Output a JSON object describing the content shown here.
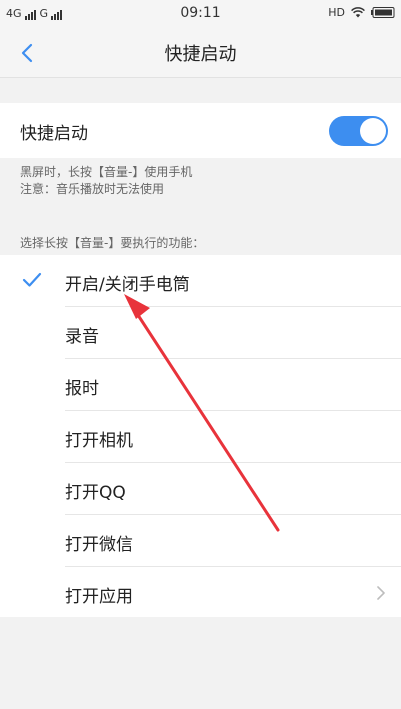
{
  "status_bar": {
    "network1": "4G",
    "network2": "G",
    "time": "09:11",
    "hd": "HD"
  },
  "nav": {
    "title": "快捷启动"
  },
  "toggle": {
    "label": "快捷启动",
    "enabled": true
  },
  "description": {
    "line1": "黑屏时，长按【音量-】使用手机",
    "line2": "注意：音乐播放时无法使用"
  },
  "section_label": "选择长按【音量-】要执行的功能：",
  "options": [
    {
      "label": "开启/关闭手电筒",
      "selected": true
    },
    {
      "label": "录音",
      "selected": false
    },
    {
      "label": "报时",
      "selected": false
    },
    {
      "label": "打开相机",
      "selected": false
    },
    {
      "label": "打开QQ",
      "selected": false
    },
    {
      "label": "打开微信",
      "selected": false
    },
    {
      "label": "打开应用",
      "selected": false,
      "has_chevron": true
    }
  ],
  "colors": {
    "accent": "#3d8ef0",
    "check": "#3d8ef0",
    "annotation_arrow": "#e8333b"
  },
  "icons": {
    "back": "chevron-left",
    "check": "checkmark",
    "wifi": "wifi",
    "battery": "battery",
    "chevron": "chevron-right"
  }
}
